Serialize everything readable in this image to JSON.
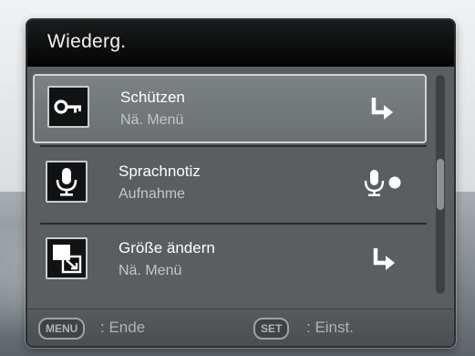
{
  "title": "Wiederg.",
  "items": [
    {
      "label": "Schützen",
      "sub": "Nä. Menü",
      "icon": "key-icon",
      "action_icon": "enter-arrow-icon",
      "selected": true
    },
    {
      "label": "Sprachnotiz",
      "sub": "Aufnahme",
      "icon": "microphone-icon",
      "action_icon": "record-mic-icon",
      "selected": false
    },
    {
      "label": "Größe ändern",
      "sub": "Nä. Menü",
      "icon": "resize-icon",
      "action_icon": "enter-arrow-icon",
      "selected": false
    }
  ],
  "footer": {
    "menu_key": "MENU",
    "menu_action": ": Ende",
    "set_key": "SET",
    "set_action": ": Einst."
  }
}
